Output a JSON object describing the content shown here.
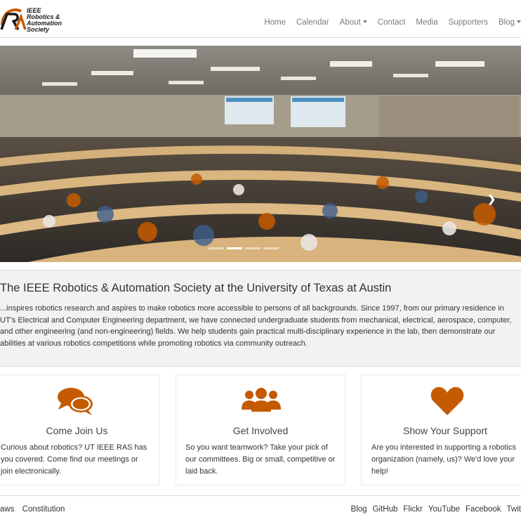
{
  "brand": {
    "logo_line1": "IEEE",
    "logo_line2": "Robotics &",
    "logo_line3": "Automation",
    "logo_line4": "Society",
    "accent_color": "#c65a00"
  },
  "nav": {
    "items": [
      {
        "label": "Home"
      },
      {
        "label": "Calendar"
      },
      {
        "label": "About"
      },
      {
        "label": "Contact"
      },
      {
        "label": "Media"
      },
      {
        "label": "Supporters"
      },
      {
        "label": "Blog"
      }
    ]
  },
  "carousel": {
    "next_icon": "chevron-right-icon",
    "indicator_count": 4,
    "active_index": 1
  },
  "intro": {
    "title": "The IEEE Robotics & Automation Society at the University of Texas at Austin",
    "text": "...inspires robotics research and aspires to make robotics more accessible to persons of all backgrounds. Since 1997, from our primary residence in UT's Electrical and Computer Engineering department, we have connected undergraduate students from mechanical, electrical, aerospace, computer, and other engineering (and non-engineering) fields. We help students gain practical multi-disciplinary experience in the lab, then demonstrate our abilities at various robotics competitions while promoting robotics via community outreach."
  },
  "cards": [
    {
      "icon": "comments-icon",
      "title": "Come Join Us",
      "text": "Curious about robotics? UT IEEE RAS has you covered. Come find our meetings or join electronically."
    },
    {
      "icon": "users-icon",
      "title": "Get Involved",
      "text": "So you want teamwork? Take your pick of our committees. Big or small, competitive or laid back."
    },
    {
      "icon": "heart-icon",
      "title": "Show Your Support",
      "text": "Are you interested in supporting a robotics organization (namely, us)? We'd love your help!"
    }
  ],
  "footer": {
    "left": [
      {
        "label": "aws"
      },
      {
        "label": "Constitution"
      }
    ],
    "right": [
      {
        "label": "Blog"
      },
      {
        "label": "GitHub"
      },
      {
        "label": "Flickr"
      },
      {
        "label": "YouTube"
      },
      {
        "label": "Facebook"
      },
      {
        "label": "Twit"
      }
    ]
  }
}
